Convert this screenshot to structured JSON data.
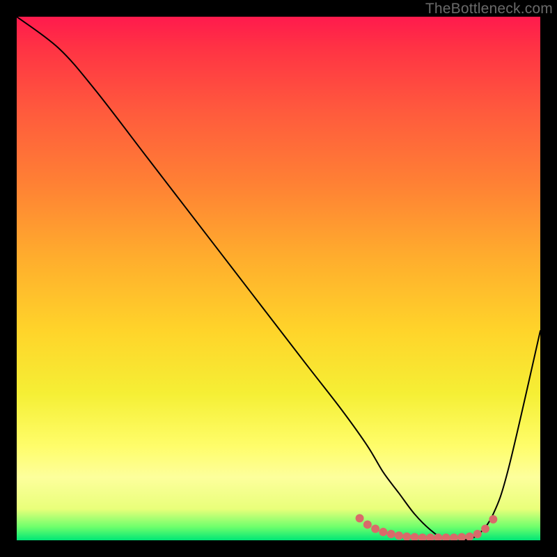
{
  "watermark": "TheBottleneck.com",
  "chart_data": {
    "type": "line",
    "title": "",
    "xlabel": "",
    "ylabel": "",
    "xlim": [
      0,
      100
    ],
    "ylim": [
      0,
      100
    ],
    "grid": false,
    "legend": false,
    "series": [
      {
        "name": "bottleneck-curve",
        "x": [
          0,
          8,
          15,
          25,
          35,
          45,
          55,
          62,
          67,
          70,
          73,
          76,
          79,
          82,
          85,
          88,
          91,
          94,
          100
        ],
        "values": [
          100,
          94,
          86,
          73,
          60,
          47,
          34,
          25,
          18,
          13,
          9,
          5,
          2,
          0,
          0,
          1,
          5,
          14,
          40
        ],
        "stroke": "#000000",
        "stroke_width": 2
      }
    ],
    "markers": {
      "name": "valley-markers",
      "color": "#d96a6a",
      "radius": 6,
      "points": [
        {
          "x": 65.5,
          "y": 4.2
        },
        {
          "x": 67.0,
          "y": 3.0
        },
        {
          "x": 68.5,
          "y": 2.2
        },
        {
          "x": 70.0,
          "y": 1.6
        },
        {
          "x": 71.5,
          "y": 1.2
        },
        {
          "x": 73.0,
          "y": 0.9
        },
        {
          "x": 74.5,
          "y": 0.7
        },
        {
          "x": 76.0,
          "y": 0.6
        },
        {
          "x": 77.5,
          "y": 0.5
        },
        {
          "x": 79.0,
          "y": 0.5
        },
        {
          "x": 80.5,
          "y": 0.5
        },
        {
          "x": 82.0,
          "y": 0.5
        },
        {
          "x": 83.5,
          "y": 0.5
        },
        {
          "x": 85.0,
          "y": 0.6
        },
        {
          "x": 86.5,
          "y": 0.7
        },
        {
          "x": 88.0,
          "y": 1.2
        },
        {
          "x": 89.5,
          "y": 2.2
        },
        {
          "x": 91.0,
          "y": 4.0
        }
      ]
    }
  }
}
